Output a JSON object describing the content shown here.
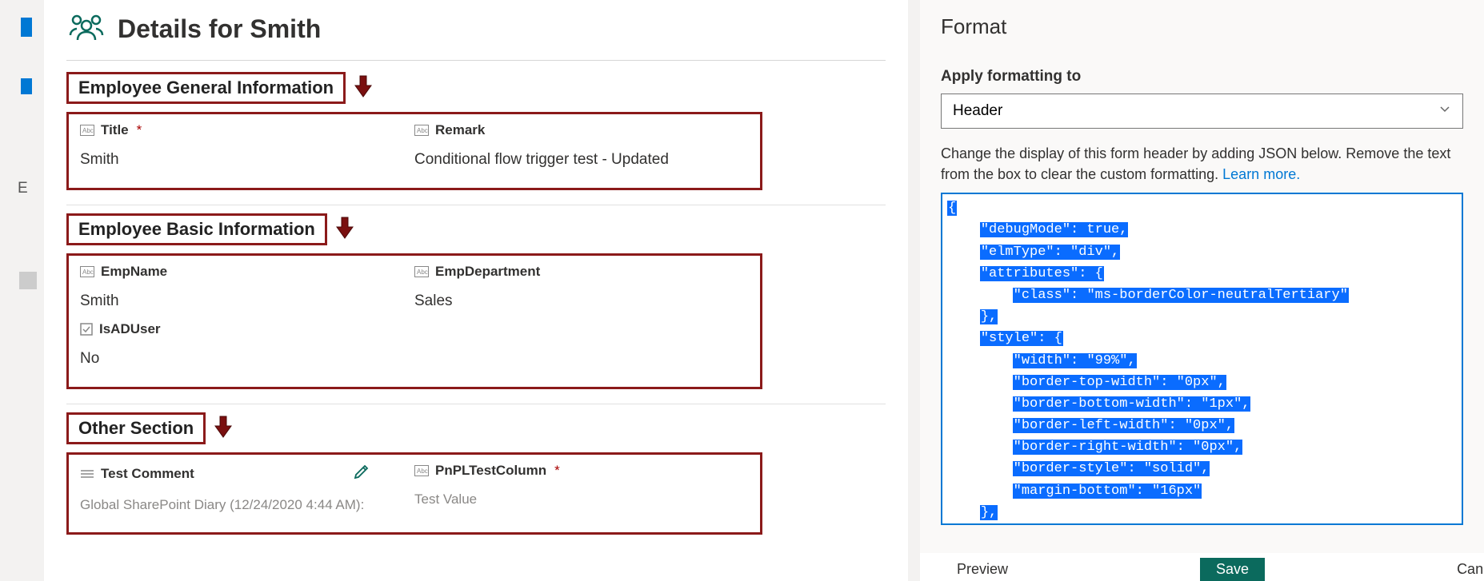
{
  "leftText": "E",
  "header": {
    "title": "Details for Smith"
  },
  "sections": [
    {
      "heading": "Employee General Information",
      "fields": [
        {
          "icon": "text",
          "label": "Title",
          "required": true,
          "value": "Smith",
          "editable": false
        },
        {
          "icon": "text",
          "label": "Remark",
          "required": false,
          "value": "Conditional flow trigger test - Updated",
          "editable": false
        }
      ]
    },
    {
      "heading": "Employee Basic Information",
      "fields": [
        {
          "icon": "text",
          "label": "EmpName",
          "required": false,
          "value": "Smith",
          "editable": false
        },
        {
          "icon": "text",
          "label": "EmpDepartment",
          "required": false,
          "value": "Sales",
          "editable": false
        },
        {
          "icon": "check",
          "label": "IsADUser",
          "required": false,
          "value": "No",
          "editable": false
        }
      ]
    },
    {
      "heading": "Other Section",
      "fields": [
        {
          "icon": "multi",
          "label": "Test Comment",
          "required": false,
          "value": "Global SharePoint Diary (12/24/2020 4:44 AM):",
          "faded": true,
          "editable": true
        },
        {
          "icon": "text",
          "label": "PnPLTestColumn",
          "required": true,
          "value": "Test Value",
          "faded": true,
          "editable": false
        }
      ]
    }
  ],
  "formatPanel": {
    "title": "Format",
    "applyLabel": "Apply formatting to",
    "selectValue": "Header",
    "helpText": "Change the display of this form header by adding JSON below. Remove the text from the box to clear the custom formatting. ",
    "learnMore": "Learn more.",
    "jsonLines": [
      {
        "indent": 0,
        "text": "{"
      },
      {
        "indent": 1,
        "text": "\"debugMode\": true,"
      },
      {
        "indent": 1,
        "text": "\"elmType\": \"div\","
      },
      {
        "indent": 1,
        "text": "\"attributes\": {"
      },
      {
        "indent": 2,
        "text": "\"class\": \"ms-borderColor-neutralTertiary\""
      },
      {
        "indent": 1,
        "text": "},"
      },
      {
        "indent": 1,
        "text": "\"style\": {"
      },
      {
        "indent": 2,
        "text": "\"width\": \"99%\","
      },
      {
        "indent": 2,
        "text": "\"border-top-width\": \"0px\","
      },
      {
        "indent": 2,
        "text": "\"border-bottom-width\": \"1px\","
      },
      {
        "indent": 2,
        "text": "\"border-left-width\": \"0px\","
      },
      {
        "indent": 2,
        "text": "\"border-right-width\": \"0px\","
      },
      {
        "indent": 2,
        "text": "\"border-style\": \"solid\","
      },
      {
        "indent": 2,
        "text": "\"margin-bottom\": \"16px\""
      },
      {
        "indent": 1,
        "text": "},"
      }
    ],
    "buttons": {
      "preview": "Preview",
      "save": "Save",
      "cancel": "Cancel"
    }
  }
}
